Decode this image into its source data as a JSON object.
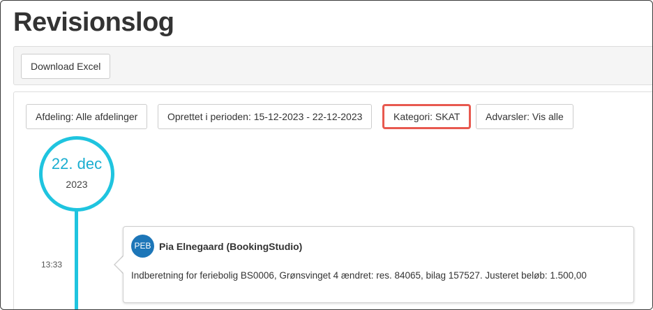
{
  "page": {
    "title": "Revisionslog"
  },
  "toolbar": {
    "download_label": "Download Excel"
  },
  "filters": [
    {
      "label": "Afdeling: Alle afdelinger"
    },
    {
      "label": "Oprettet i perioden: 15-12-2023 - 22-12-2023"
    },
    {
      "label": "Kategori: SKAT",
      "highlighted": true
    },
    {
      "label": "Advarsler: Vis alle"
    }
  ],
  "timeline": {
    "date_day": "22. dec",
    "date_year": "2023",
    "entries": [
      {
        "time": "13:33",
        "avatar_initials": "PEB",
        "author": "Pia Elnegaard (BookingStudio)",
        "text": "Indberetning for feriebolig BS0006, Grønsvinget 4 ændret: res. 84065, bilag 157527. Justeret beløb: 1.500,00"
      }
    ]
  },
  "colors": {
    "accent": "#1fc4df",
    "highlight_border": "#e8594f",
    "avatar": "#1d76b8"
  }
}
